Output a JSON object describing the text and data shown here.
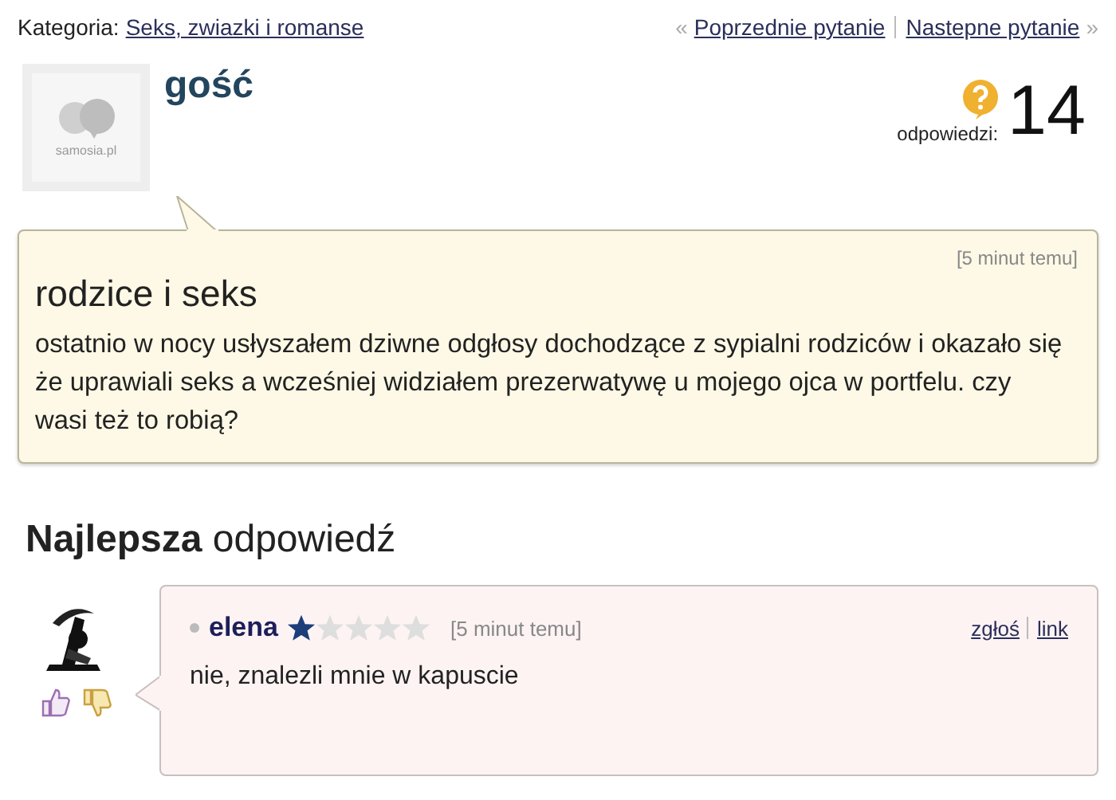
{
  "breadcrumb": {
    "label": "Kategoria:",
    "category": "Seks, zwiazki i romanse"
  },
  "nav": {
    "prev_mark": "«",
    "prev": "Poprzednie pytanie",
    "next": "Nastepne pytanie",
    "next_mark": "»"
  },
  "question": {
    "author": "gość",
    "avatar_logo": "samosia.pl",
    "answers_label": "odpowiedzi:",
    "answers_count": "14",
    "time": "[5 minut temu]",
    "title": "rodzice i seks",
    "body": "ostatnio w nocy usłyszałem dziwne odgłosy dochodzące z sypialni rodziców i okazało się że uprawiali seks a wcześniej widziałem prezerwatywę u mojego ojca w portfelu. czy wasi też to robią?"
  },
  "best_answer": {
    "heading": "**Najlepsza** odpowiedź",
    "author": "elena",
    "stars": 1,
    "time": "[5 minut temu]",
    "report": "zgłoś",
    "link": "link",
    "text": "nie, znalezli mnie w kapuscie"
  }
}
